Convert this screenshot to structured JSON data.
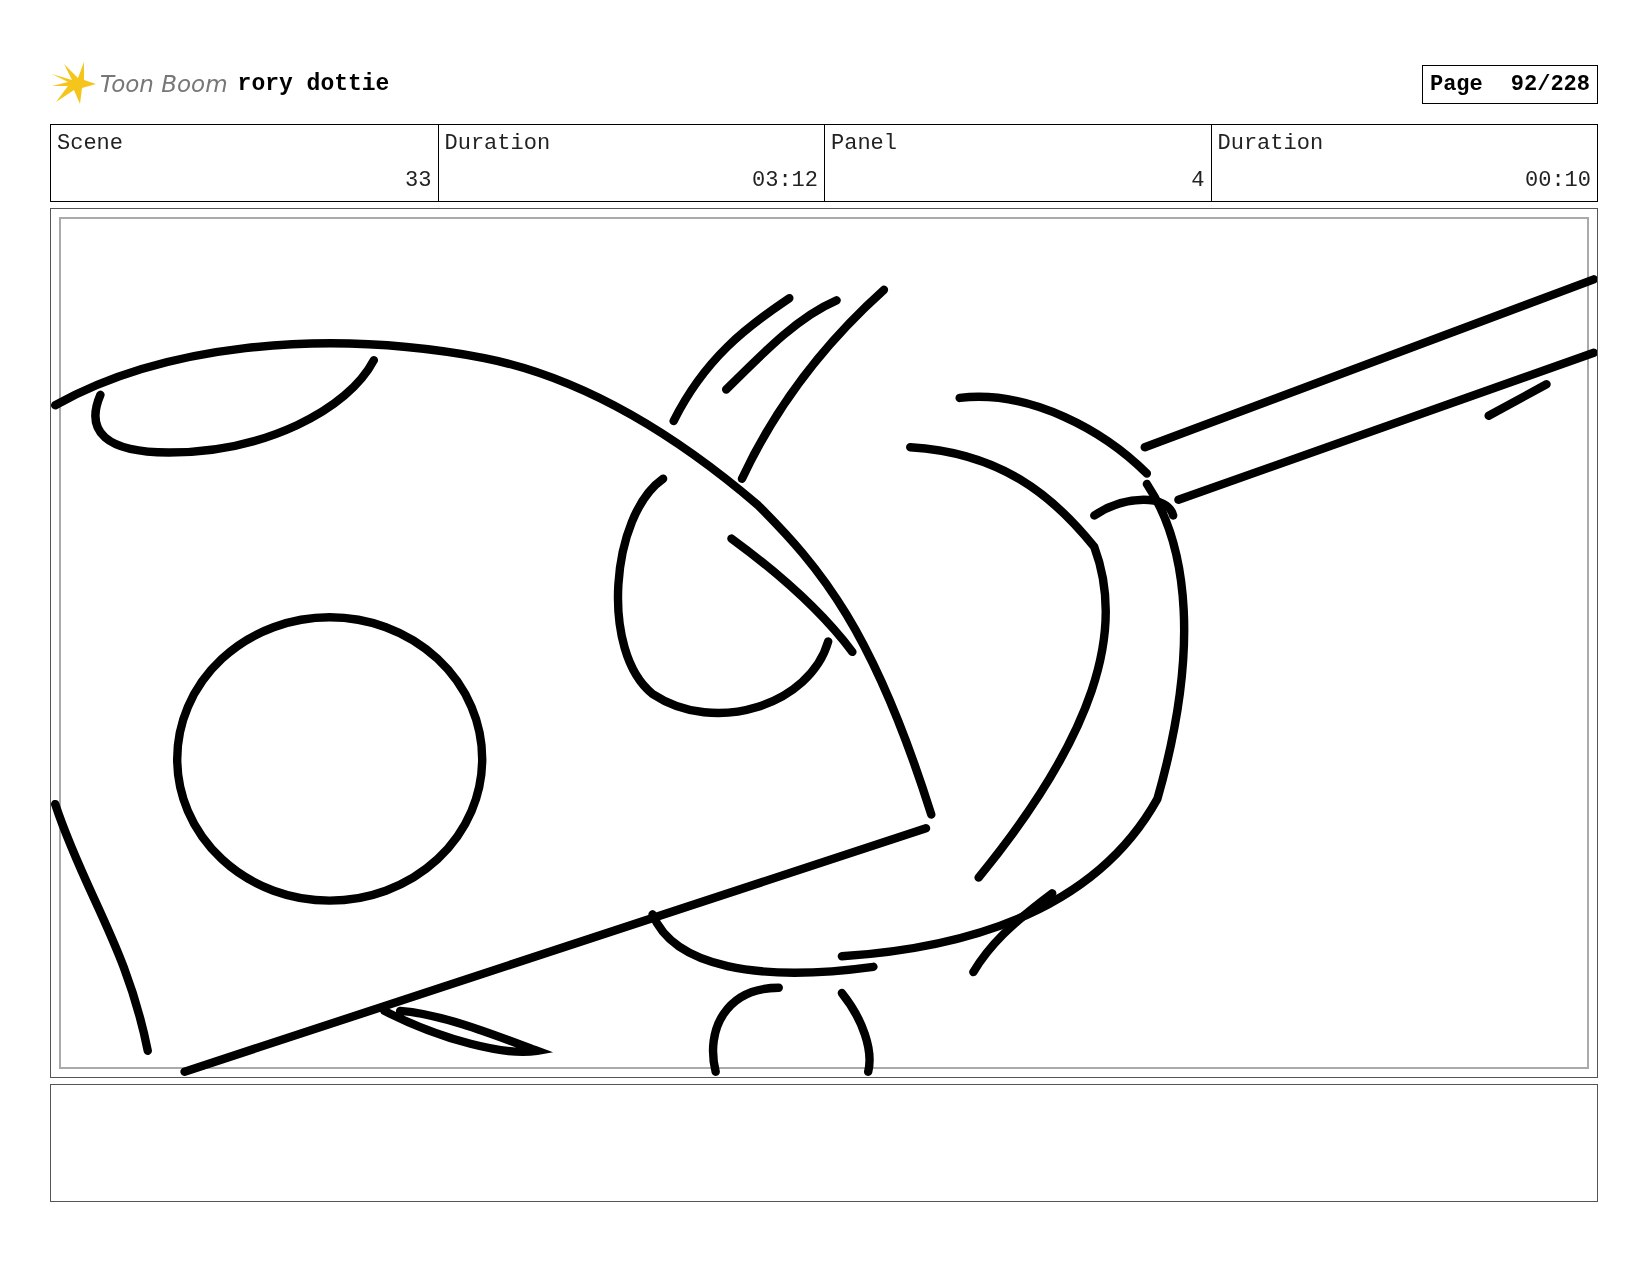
{
  "header": {
    "logo_text": "Toon Boom",
    "project": "rory dottie",
    "page_label": "Page",
    "page_number": "92/228"
  },
  "info_table": {
    "headings": [
      "Scene",
      "Duration",
      "Panel",
      "Duration"
    ],
    "entries": [
      "33",
      "03:12",
      "4",
      "00:10"
    ]
  }
}
